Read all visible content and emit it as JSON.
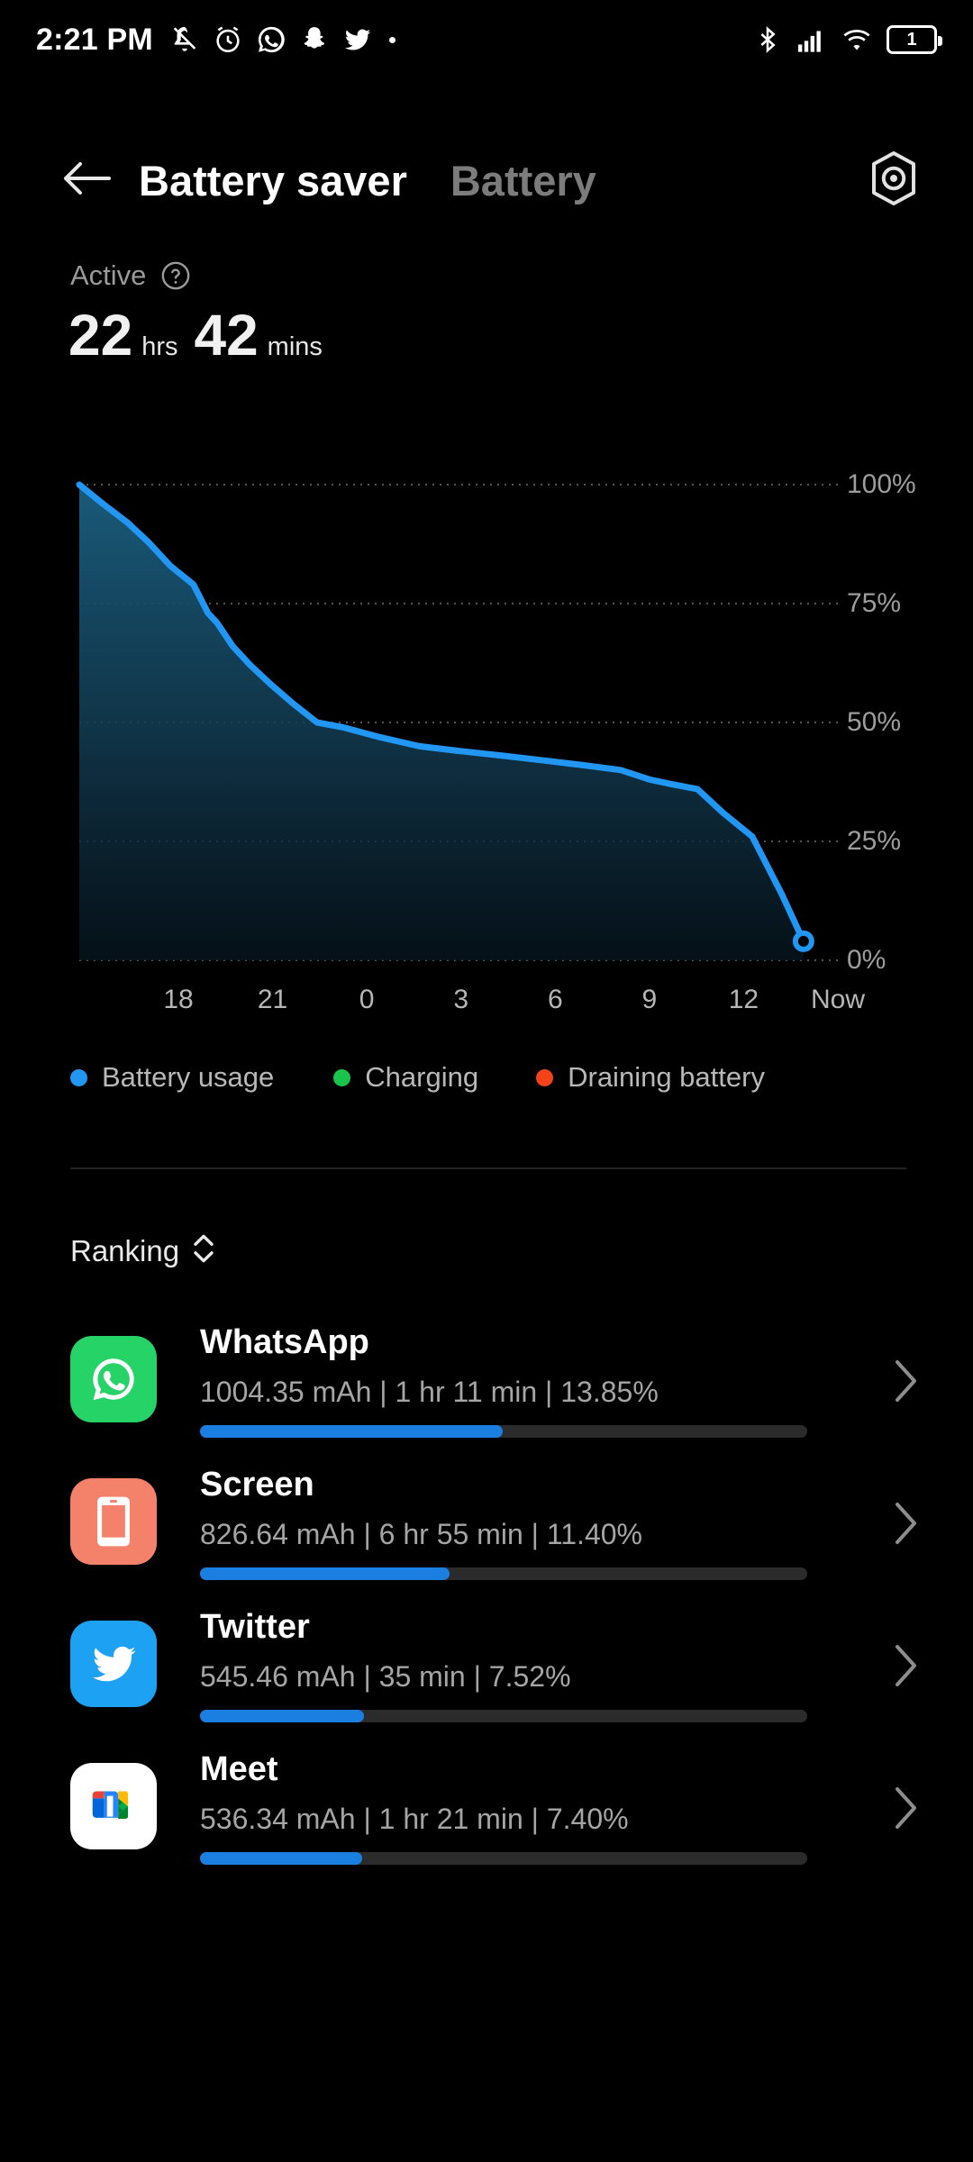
{
  "status_bar": {
    "time": "2:21 PM",
    "left_icons": [
      "bell-mute-icon",
      "alarm-icon",
      "whatsapp-icon",
      "snapchat-icon",
      "twitter-icon",
      "dot-icon"
    ],
    "right_icons": [
      "bluetooth-icon",
      "cellular-signal-icon",
      "wifi-icon"
    ],
    "battery_level_text": "1"
  },
  "app_bar": {
    "back_icon": "back-arrow-icon",
    "title": "Battery saver",
    "secondary_tab": "Battery",
    "settings_icon": "gear-hexagon-icon"
  },
  "summary": {
    "label": "Active",
    "help_icon": "question-mark-icon",
    "hours_value": "22",
    "hours_unit": "hrs",
    "mins_value": "42",
    "mins_unit": "mins"
  },
  "chart_data": {
    "type": "area",
    "title": "",
    "xlabel": "",
    "ylabel": "",
    "x_tick_labels": [
      "18",
      "21",
      "0",
      "3",
      "6",
      "9",
      "12",
      "Now"
    ],
    "y_tick_labels": [
      "100%",
      "75%",
      "50%",
      "25%",
      "0%"
    ],
    "ylim": [
      0,
      100
    ],
    "grid": true,
    "grid_style": "dotted",
    "line_color": "#2196f3",
    "fill_gradient": [
      "#1a5a7a",
      "#0a1a24"
    ],
    "end_marker": true,
    "series": [
      {
        "name": "Battery usage",
        "x": [
          0,
          3.2,
          6.6,
          9.4,
          12.4,
          15.6,
          17.6,
          18.8,
          21.0,
          23.4,
          26.2,
          29.2,
          32.5,
          36.0,
          40.8,
          46.5,
          52.0,
          58.0,
          63.5,
          69.0,
          74.0,
          78.0,
          81.0,
          84.5,
          88.0,
          92.0,
          96.0,
          99.0
        ],
        "y": [
          100,
          96,
          92,
          88,
          83,
          79,
          73,
          71,
          66,
          62,
          58,
          54,
          50,
          49,
          47,
          45,
          44,
          43,
          42,
          41,
          40,
          38,
          37,
          36,
          31,
          26,
          14,
          4
        ]
      }
    ],
    "legend_position": "below",
    "legend": [
      {
        "label": "Battery usage",
        "color": "#2196f3"
      },
      {
        "label": "Charging",
        "color": "#19c44a"
      },
      {
        "label": "Draining battery",
        "color": "#f4421a"
      }
    ]
  },
  "ranking": {
    "label": "Ranking",
    "sort_icon": "sort-updown-icon"
  },
  "apps": [
    {
      "name": "WhatsApp",
      "icon": "whatsapp-icon",
      "icon_bg": "#25d366",
      "stats": "1004.35 mAh | 1 hr 11 min  | 13.85%",
      "mah": "1004.35 mAh",
      "duration": "1 hr 11 min",
      "percent": "13.85%",
      "bar_percent": 13.85,
      "chevron_icon": "chevron-right-icon"
    },
    {
      "name": "Screen",
      "icon": "screen-icon",
      "icon_bg": "#f4826a",
      "stats": "826.64 mAh | 6 hr 55 min  | 11.40%",
      "mah": "826.64 mAh",
      "duration": "6 hr 55 min",
      "percent": "11.40%",
      "bar_percent": 11.4,
      "chevron_icon": "chevron-right-icon"
    },
    {
      "name": "Twitter",
      "icon": "twitter-icon",
      "icon_bg": "#1da1f2",
      "stats": "545.46 mAh | 35 min  | 7.52%",
      "mah": "545.46 mAh",
      "duration": "35 min",
      "percent": "7.52%",
      "bar_percent": 7.52,
      "chevron_icon": "chevron-right-icon"
    },
    {
      "name": "Meet",
      "icon": "google-meet-icon",
      "icon_bg": "#ffffff",
      "stats": "536.34 mAh | 1 hr 21 min  | 7.40%",
      "mah": "536.34 mAh",
      "duration": "1 hr 21 min",
      "percent": "7.40%",
      "bar_percent": 7.4,
      "chevron_icon": "chevron-right-icon"
    }
  ]
}
